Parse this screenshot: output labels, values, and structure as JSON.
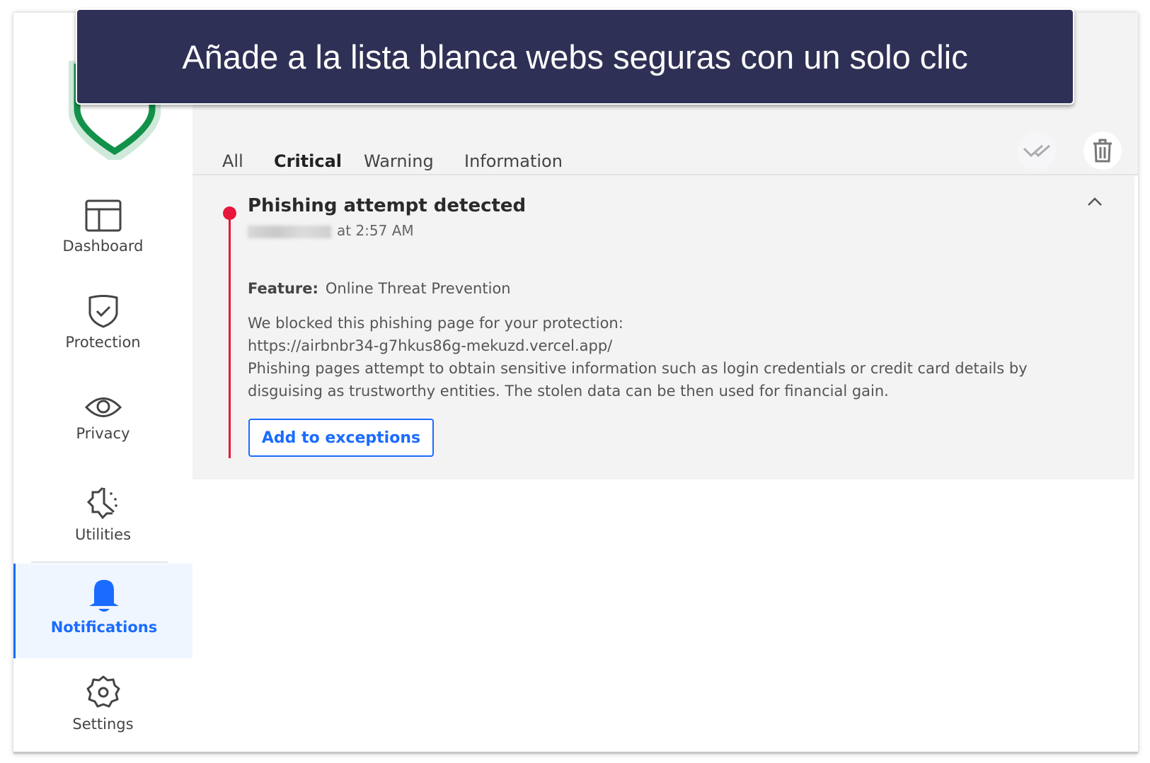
{
  "banner": {
    "text": "Añade a la lista blanca webs seguras con un solo clic"
  },
  "sidebar": {
    "items": [
      {
        "label": "Dashboard",
        "icon": "dashboard-icon"
      },
      {
        "label": "Protection",
        "icon": "shield-check-icon"
      },
      {
        "label": "Privacy",
        "icon": "eye-icon"
      },
      {
        "label": "Utilities",
        "icon": "utilities-icon"
      },
      {
        "label": "Notifications",
        "icon": "bell-icon",
        "active": true
      },
      {
        "label": "Settings",
        "icon": "gear-icon"
      }
    ]
  },
  "tabs": [
    {
      "label": "All"
    },
    {
      "label": "Critical",
      "active": true
    },
    {
      "label": "Warning"
    },
    {
      "label": "Information"
    }
  ],
  "toolbar": {
    "mark_all_read_icon": "double-check-icon",
    "delete_icon": "trash-icon"
  },
  "notification": {
    "title": "Phishing attempt detected",
    "time": "at 2:57 AM",
    "feature_label": "Feature:",
    "feature_value": "Online Threat Prevention",
    "desc_line1": "We blocked this phishing page for your protection:",
    "url": "https://airbnbr34-g7hkus86g-mekuzd.vercel.app/",
    "desc_line2": "Phishing pages attempt to obtain sensitive information such as login credentials or credit card details by disguising as trustworthy entities. The stolen data can be then used for financial gain.",
    "button": "Add to exceptions",
    "severity_color": "#e8163a"
  },
  "colors": {
    "accent": "#1a6cff",
    "banner_bg": "#2f3055",
    "logo_green": "#12914a"
  }
}
